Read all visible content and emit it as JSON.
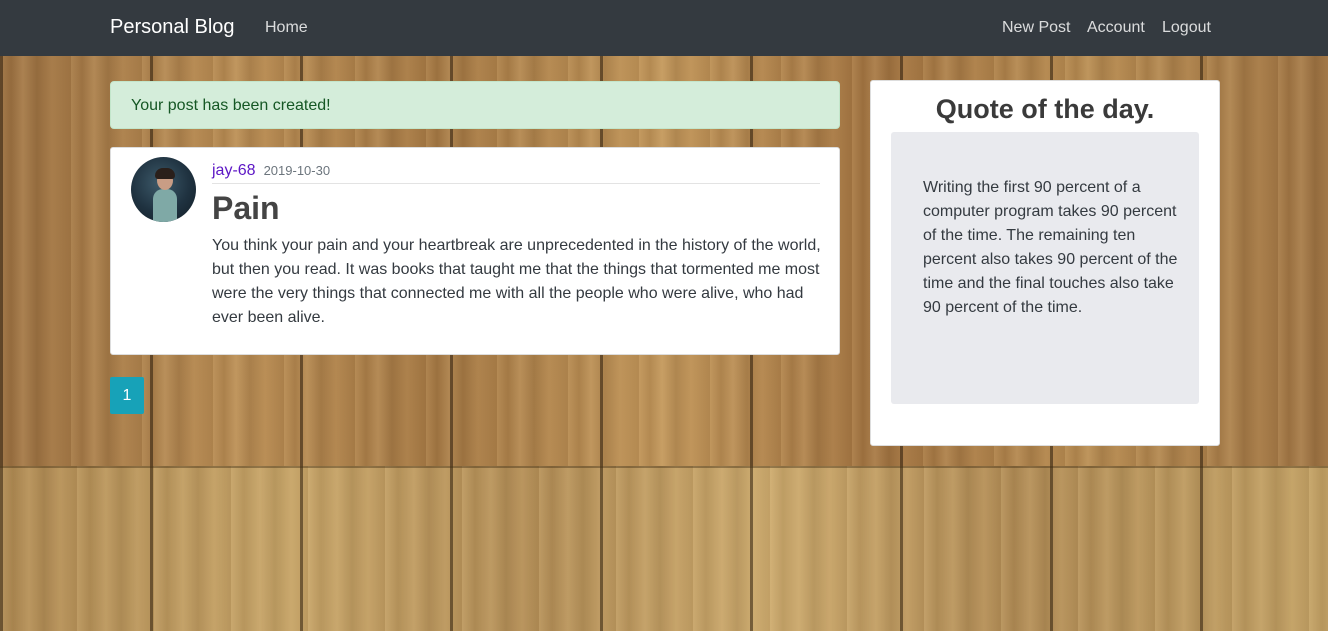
{
  "navbar": {
    "brand": "Personal Blog",
    "home": "Home",
    "new_post": "New Post",
    "account": "Account",
    "logout": "Logout"
  },
  "alert": {
    "message": "Your post has been created!"
  },
  "post": {
    "author": "jay-68",
    "date": "2019-10-30",
    "title": "Pain",
    "body": "You think your pain and your heartbreak are unprecedented in the history of the world, but then you read. It was books that taught me that the things that tormented me most were the very things that connected me with all the people who were alive, who had ever been alive."
  },
  "pagination": {
    "current_page": "1"
  },
  "sidebar": {
    "title": "Quote of the day.",
    "quote": "Writing the first 90 percent of a computer program takes 90 percent of the time. The remaining ten percent also takes 90 percent of the time and the final touches also take 90 percent of the time."
  },
  "colors": {
    "navbar_bg": "#343a40",
    "alert_bg": "#d4edda",
    "alert_text": "#155724",
    "author_link": "#5c16c5",
    "page_button": "#17a2b8",
    "quote_bg": "#e9eaee"
  }
}
